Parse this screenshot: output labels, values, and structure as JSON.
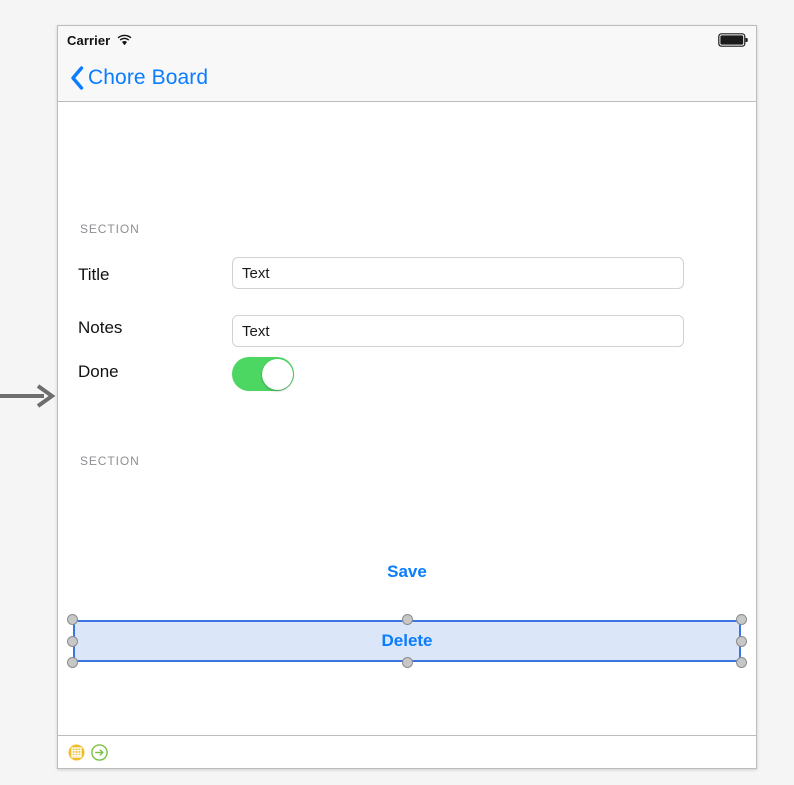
{
  "annotation": {
    "arrow_icon": "arrow-right-icon",
    "arrow_color": "#6e6e6e"
  },
  "scene": {
    "status_bar": {
      "carrier": "Carrier",
      "wifi_icon": "wifi-icon",
      "battery_icon": "battery-full-icon"
    },
    "nav_bar": {
      "back_icon": "chevron-left-icon",
      "back_label": "Chore Board",
      "tint_color": "#0a7cff"
    },
    "table": {
      "sections": [
        {
          "header": "SECTION",
          "rows": [
            {
              "label": "Title",
              "control": "textfield",
              "value": "Text",
              "placeholder": "Text"
            },
            {
              "label": "Notes",
              "control": "textfield",
              "value": "Text",
              "placeholder": "Text"
            },
            {
              "label": "Done",
              "control": "switch",
              "value": "on"
            }
          ]
        },
        {
          "header": "SECTION",
          "rows": []
        }
      ]
    },
    "buttons": {
      "save": {
        "label": "Save",
        "color": "#0a7cff",
        "selected": false
      },
      "delete": {
        "label": "Delete",
        "color": "#0a7cff",
        "selected": true,
        "selection_fill": "#dbe6f8",
        "selection_stroke": "#3b76e0",
        "handle_count": 8
      }
    },
    "dock": {
      "items": [
        {
          "icon": "view-controller-icon",
          "color": "#f0bc28"
        },
        {
          "icon": "exit-segue-icon",
          "color": "#7bc043"
        }
      ]
    }
  },
  "colors": {
    "canvas_background": "#f5f5f5",
    "scene_background": "#ffffff",
    "bar_background": "#f8f8f8",
    "switch_on": "#4cd662",
    "section_header_text": "#8e8e93"
  }
}
